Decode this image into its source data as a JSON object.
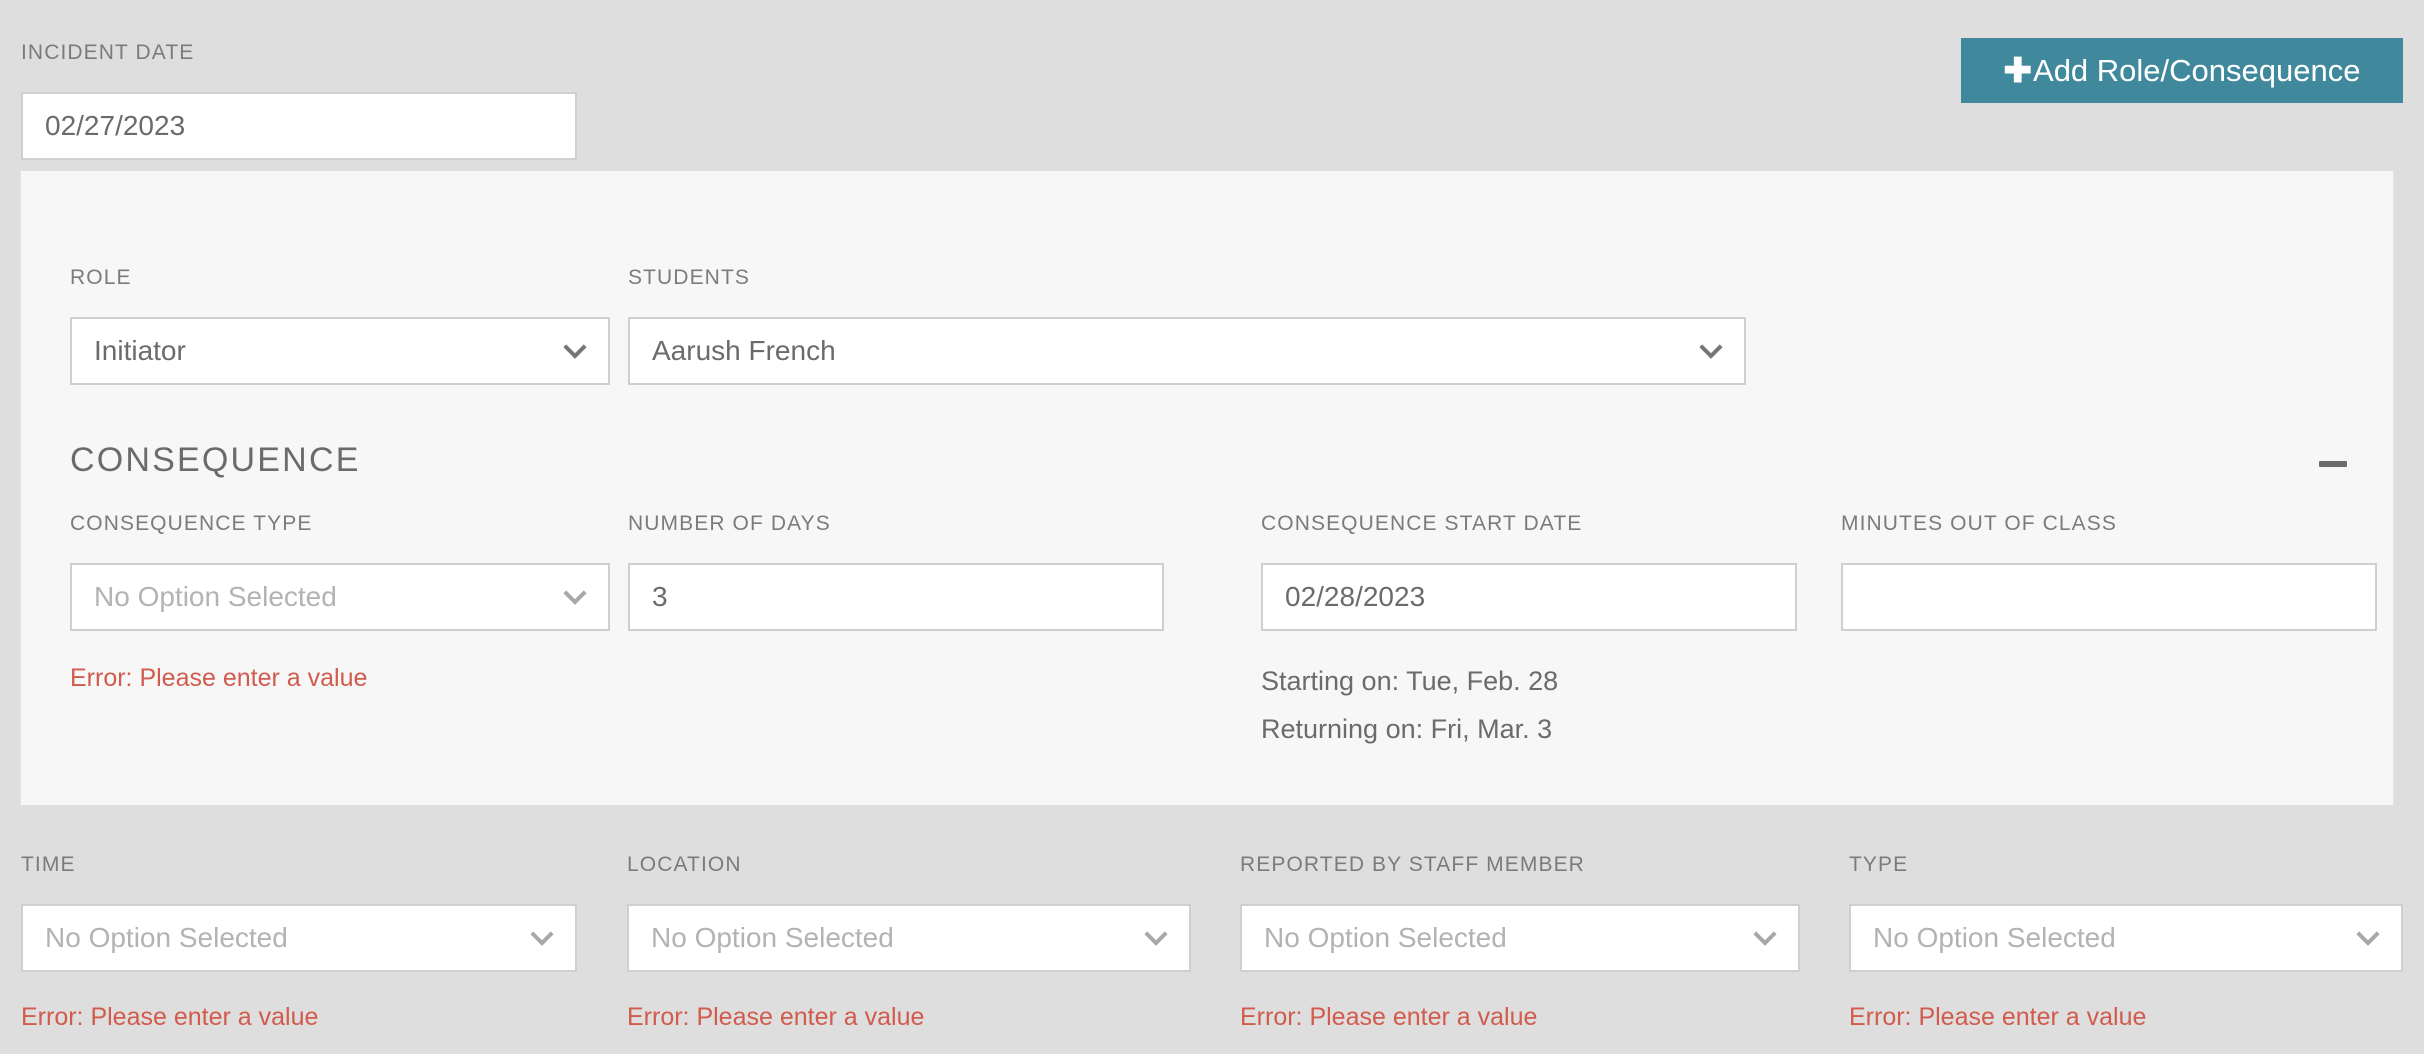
{
  "topbar": {
    "incident_date_label": "INCIDENT DATE",
    "incident_date_value": "02/27/2023",
    "add_button_plus": "✚",
    "add_button_label": "Add Role/Consequence",
    "add_button_color": "#40899c"
  },
  "panel": {
    "role": {
      "label": "ROLE",
      "value": "Initiator",
      "icon": "chevron-down-icon"
    },
    "students": {
      "label": "STUDENTS",
      "value": "Aarush French",
      "icon": "chevron-down-icon"
    },
    "consequence_section": {
      "title": "CONSEQUENCE",
      "collapse_icon": "minus-icon",
      "fields": [
        {
          "label": "CONSEQUENCE TYPE",
          "value": "No Option Selected",
          "is_placeholder": true,
          "control": "select",
          "icon": "chevron-down-icon",
          "error": "Error: Please enter a value"
        },
        {
          "label": "NUMBER OF DAYS",
          "value": "3",
          "is_placeholder": false,
          "control": "text",
          "error": ""
        },
        {
          "label": "CONSEQUENCE START DATE",
          "value": "02/28/2023",
          "is_placeholder": false,
          "control": "text",
          "error": "",
          "notes": [
            "Starting on: Tue, Feb. 28",
            "Returning on: Fri, Mar. 3"
          ]
        },
        {
          "label": "MINUTES OUT OF CLASS",
          "value": "",
          "is_placeholder": false,
          "control": "text",
          "error": ""
        }
      ]
    }
  },
  "bottom_row": {
    "fields": [
      {
        "label": "TIME",
        "value": "No Option Selected",
        "icon": "chevron-down-icon",
        "error": "Error: Please enter a value"
      },
      {
        "label": "LOCATION",
        "value": "No Option Selected",
        "icon": "chevron-down-icon",
        "error": "Error: Please enter a value"
      },
      {
        "label": "REPORTED BY STAFF MEMBER",
        "value": "No Option Selected",
        "icon": "chevron-down-icon",
        "error": "Error: Please enter a value"
      },
      {
        "label": "TYPE",
        "value": "No Option Selected",
        "icon": "chevron-down-icon",
        "error": "Error: Please enter a value"
      }
    ]
  },
  "colors": {
    "page_background": "#dedede",
    "panel_background": "#f7f7f7",
    "accent": "#40899c",
    "error": "#d15b4c",
    "label_text": "#7b7b7b",
    "value_text": "#6b6b6b",
    "placeholder_text": "#b3b3b3",
    "input_border": "#cfcfcf"
  }
}
